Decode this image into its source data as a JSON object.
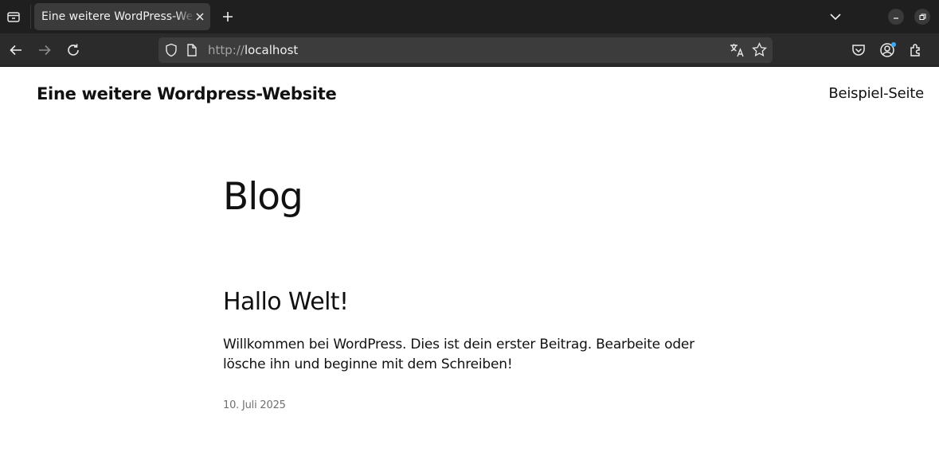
{
  "browser": {
    "tab": {
      "title": "Eine weitere WordPress-Website"
    },
    "url": {
      "protocol": "http://",
      "host": "localhost"
    },
    "colors": {
      "tabbar": "#1f1f1f",
      "navbar": "#2b2b2b",
      "urlbar": "#3c3c3c",
      "tab_active": "#3b3b3b",
      "account_dot": "#3fa9f5"
    },
    "icons": [
      "tab-manager-icon",
      "close-icon",
      "plus-icon",
      "chevron-down-icon",
      "minimize-icon",
      "restore-icon",
      "back-arrow-icon",
      "forward-arrow-icon",
      "reload-icon",
      "shield-icon",
      "page-icon",
      "translate-icon",
      "star-icon",
      "pocket-icon",
      "account-icon",
      "extensions-icon"
    ]
  },
  "site": {
    "title": "Eine weitere Wordpress-Website",
    "nav": {
      "link": "Beispiel-Seite"
    }
  },
  "main": {
    "heading": "Blog",
    "posts": [
      {
        "title": "Hallo Welt!",
        "excerpt": "Willkommen bei WordPress. Dies ist dein erster Beitrag. Bearbeite oder lösche ihn und beginne mit dem Schreiben!",
        "date": "10. Juli 2025"
      }
    ]
  }
}
